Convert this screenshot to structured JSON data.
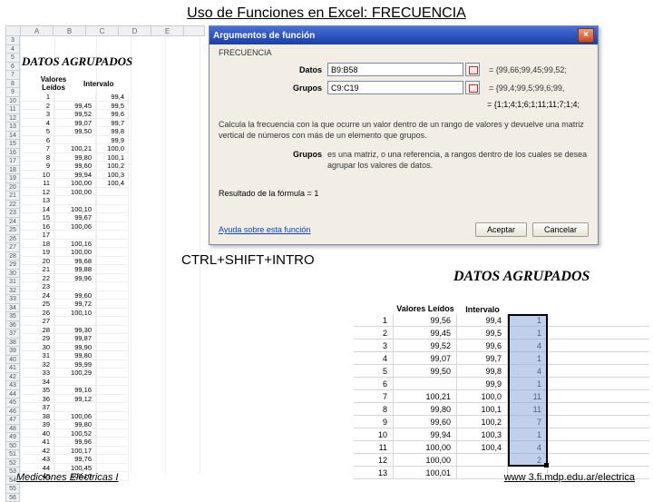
{
  "title": "Uso de Funciones en Excel: FRECUENCIA",
  "keystroke": "CTRL+SHIFT+INTRO",
  "footer_left": "Mediciones Eléctricas I",
  "footer_right": "www 3.fi.mdp.edu.ar/electrica",
  "col_headers": [
    "A",
    "B",
    "C",
    "D",
    "E"
  ],
  "left": {
    "heading": "DATOS AGRUPADOS",
    "col1_label": "Valores\nLeídos",
    "col2_label": "Intervalo",
    "rows": [
      {
        "n": "1",
        "v": "",
        "i": "99,4"
      },
      {
        "n": "2",
        "v": "99,45",
        "i": "99,5"
      },
      {
        "n": "3",
        "v": "99,52",
        "i": "99,6"
      },
      {
        "n": "4",
        "v": "99,07",
        "i": "99,7"
      },
      {
        "n": "5",
        "v": "99,50",
        "i": "99,8"
      },
      {
        "n": "6",
        "v": "",
        "i": "99,9"
      },
      {
        "n": "7",
        "v": "100,21",
        "i": "100,0"
      },
      {
        "n": "8",
        "v": "99,80",
        "i": "100,1"
      },
      {
        "n": "9",
        "v": "99,60",
        "i": "100,2"
      },
      {
        "n": "10",
        "v": "99,94",
        "i": "100,3"
      },
      {
        "n": "11",
        "v": "100,00",
        "i": "100,4"
      },
      {
        "n": "12",
        "v": "100,00",
        "i": ""
      },
      {
        "n": "13",
        "v": "",
        "i": ""
      },
      {
        "n": "14",
        "v": "100,10",
        "i": ""
      },
      {
        "n": "15",
        "v": "99,67",
        "i": ""
      },
      {
        "n": "16",
        "v": "100,06",
        "i": ""
      },
      {
        "n": "17",
        "v": "",
        "i": ""
      },
      {
        "n": "18",
        "v": "100,16",
        "i": ""
      },
      {
        "n": "19",
        "v": "100,00",
        "i": ""
      },
      {
        "n": "20",
        "v": "99,68",
        "i": ""
      },
      {
        "n": "21",
        "v": "99,88",
        "i": ""
      },
      {
        "n": "22",
        "v": "99,96",
        "i": ""
      },
      {
        "n": "23",
        "v": "",
        "i": ""
      },
      {
        "n": "24",
        "v": "99,60",
        "i": ""
      },
      {
        "n": "25",
        "v": "99,72",
        "i": ""
      },
      {
        "n": "26",
        "v": "100,10",
        "i": ""
      },
      {
        "n": "27",
        "v": "",
        "i": ""
      },
      {
        "n": "28",
        "v": "99,30",
        "i": ""
      },
      {
        "n": "29",
        "v": "99,87",
        "i": ""
      },
      {
        "n": "30",
        "v": "99,90",
        "i": ""
      },
      {
        "n": "31",
        "v": "99,80",
        "i": ""
      },
      {
        "n": "32",
        "v": "99,99",
        "i": ""
      },
      {
        "n": "33",
        "v": "100,29",
        "i": ""
      },
      {
        "n": "34",
        "v": "",
        "i": ""
      },
      {
        "n": "35",
        "v": "99,16",
        "i": ""
      },
      {
        "n": "36",
        "v": "99,12",
        "i": ""
      },
      {
        "n": "37",
        "v": "",
        "i": ""
      },
      {
        "n": "38",
        "v": "100,06",
        "i": ""
      },
      {
        "n": "39",
        "v": "99,80",
        "i": ""
      },
      {
        "n": "40",
        "v": "100,52",
        "i": ""
      },
      {
        "n": "41",
        "v": "99,96",
        "i": ""
      },
      {
        "n": "42",
        "v": "100,17",
        "i": ""
      },
      {
        "n": "43",
        "v": "99,76",
        "i": ""
      },
      {
        "n": "44",
        "v": "100,45",
        "i": ""
      },
      {
        "n": "45",
        "v": "100,10",
        "i": ""
      }
    ]
  },
  "dialog": {
    "title": "Argumentos de función",
    "fn_name": "FRECUENCIA",
    "arg1_label": "Datos",
    "arg1_value": "B9:B58",
    "arg1_preview": "= {99,66;99,45;99,52;",
    "arg2_label": "Grupos",
    "arg2_value": "C9:C19",
    "arg2_preview": "= {99,4;99,5;99,6;99,",
    "result_preview": "= {1;1;4;1;6;1;11;11;7;1;4;",
    "desc": "Calcula la frecuencia con la que ocurre un valor dentro de un rango de valores y devuelve una matriz vertical de números con más de un elemento que grupos.",
    "param_label": "Grupos",
    "param_desc": "es una matriz, o una referencia, a rangos dentro de los cuales se desea agrupar los valores de datos.",
    "formula_result_label": "Resultado de la fórmula =",
    "formula_result_value": "1",
    "help": "Ayuda sobre esta función",
    "btn_ok": "Aceptar",
    "btn_cancel": "Cancelar"
  },
  "right": {
    "heading": "DATOS AGRUPADOS",
    "col1_label": "Valores\nLeídos",
    "col2_label": "Intervalo",
    "rows": [
      {
        "n": "1",
        "v": "99,56",
        "i": "99,4",
        "f": "1"
      },
      {
        "n": "2",
        "v": "99,45",
        "i": "99,5",
        "f": "1"
      },
      {
        "n": "3",
        "v": "99,52",
        "i": "99,6",
        "f": "4"
      },
      {
        "n": "4",
        "v": "99,07",
        "i": "99,7",
        "f": "1"
      },
      {
        "n": "5",
        "v": "99,50",
        "i": "99,8",
        "f": "4"
      },
      {
        "n": "6",
        "v": "",
        "i": "99,9",
        "f": "1"
      },
      {
        "n": "7",
        "v": "100,21",
        "i": "100,0",
        "f": "11"
      },
      {
        "n": "8",
        "v": "99,80",
        "i": "100,1",
        "f": "11"
      },
      {
        "n": "9",
        "v": "99,60",
        "i": "100,2",
        "f": "7"
      },
      {
        "n": "10",
        "v": "99,94",
        "i": "100,3",
        "f": "1"
      },
      {
        "n": "11",
        "v": "100,00",
        "i": "100,4",
        "f": "4"
      },
      {
        "n": "12",
        "v": "100,00",
        "i": "",
        "f": "2"
      },
      {
        "n": "13",
        "v": "100,01",
        "i": "",
        "f": ""
      }
    ]
  }
}
